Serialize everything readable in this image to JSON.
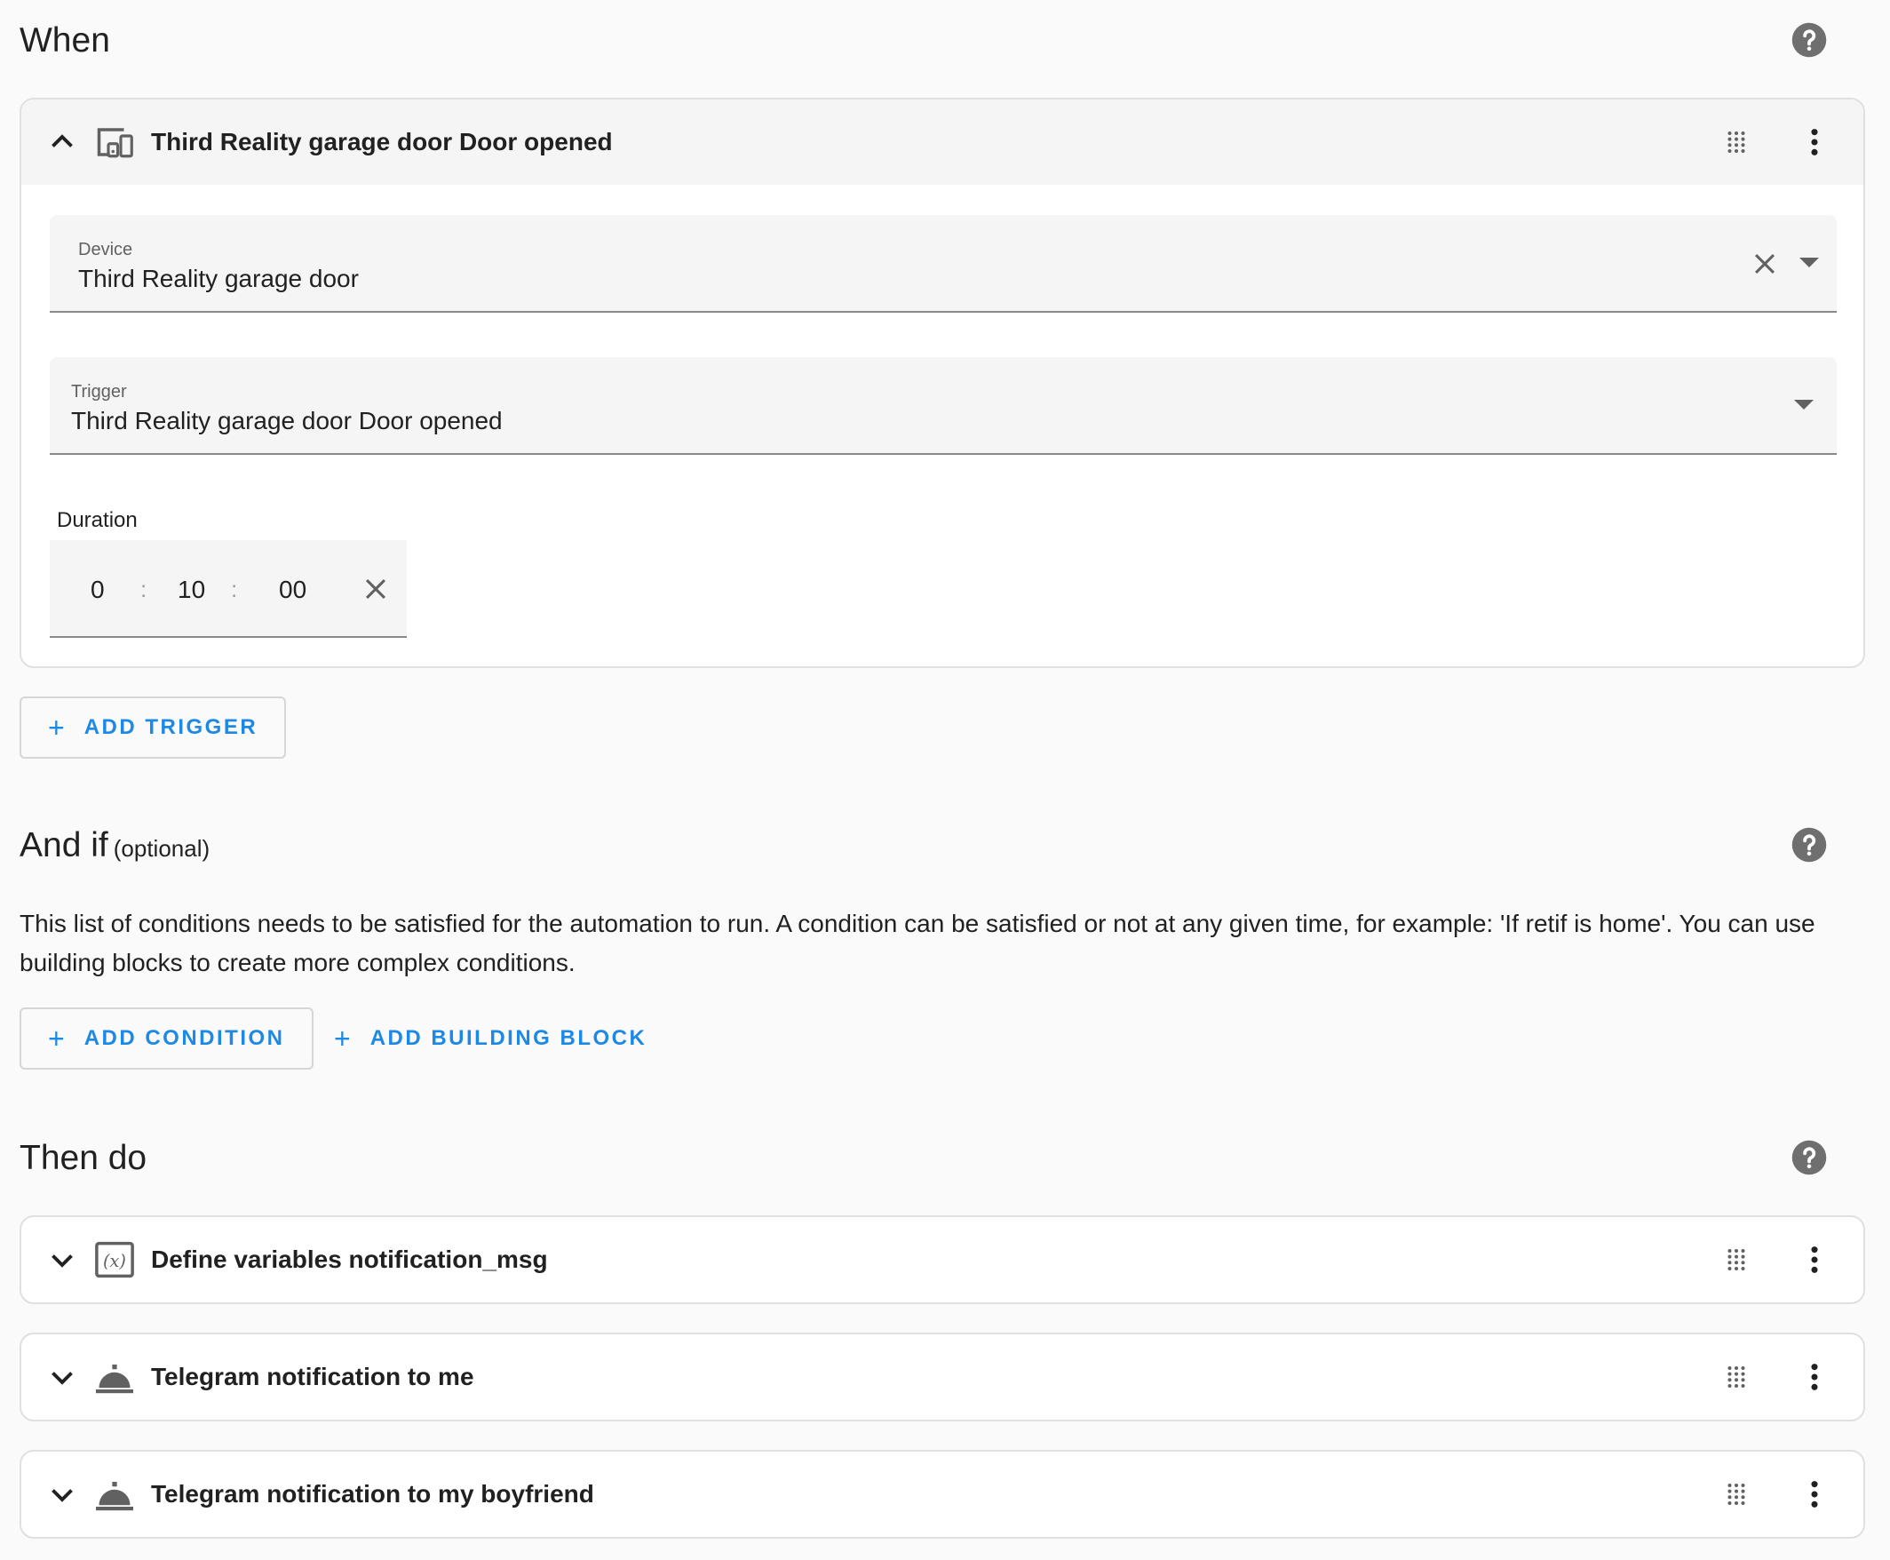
{
  "when": {
    "title": "When",
    "trigger_card": {
      "title": "Third Reality garage door Door opened",
      "device_field": {
        "label": "Device",
        "value": "Third Reality garage door"
      },
      "trigger_field": {
        "label": "Trigger",
        "value": "Third Reality garage door Door opened"
      },
      "duration": {
        "label": "Duration",
        "hours": "0",
        "minutes": "10",
        "seconds": "00",
        "separator": ":"
      }
    },
    "add_trigger_label": "ADD TRIGGER"
  },
  "and_if": {
    "title": "And if",
    "optional": "(optional)",
    "description": "This list of conditions needs to be satisfied for the automation to run. A condition can be satisfied or not at any given time, for example: 'If retif is home'. You can use building blocks to create more complex conditions.",
    "add_condition_label": "ADD CONDITION",
    "add_building_block_label": "ADD BUILDING BLOCK"
  },
  "then_do": {
    "title": "Then do",
    "actions": [
      {
        "title": "Define variables notification_msg",
        "icon": "variable-icon"
      },
      {
        "title": "Telegram notification to me",
        "icon": "service-bell-icon"
      },
      {
        "title": "Telegram notification to my boyfriend",
        "icon": "service-bell-icon"
      }
    ]
  },
  "plus_symbol": "+",
  "colors": {
    "accent": "#1e88e5",
    "icon": "#616161",
    "background": "#fafafa"
  }
}
